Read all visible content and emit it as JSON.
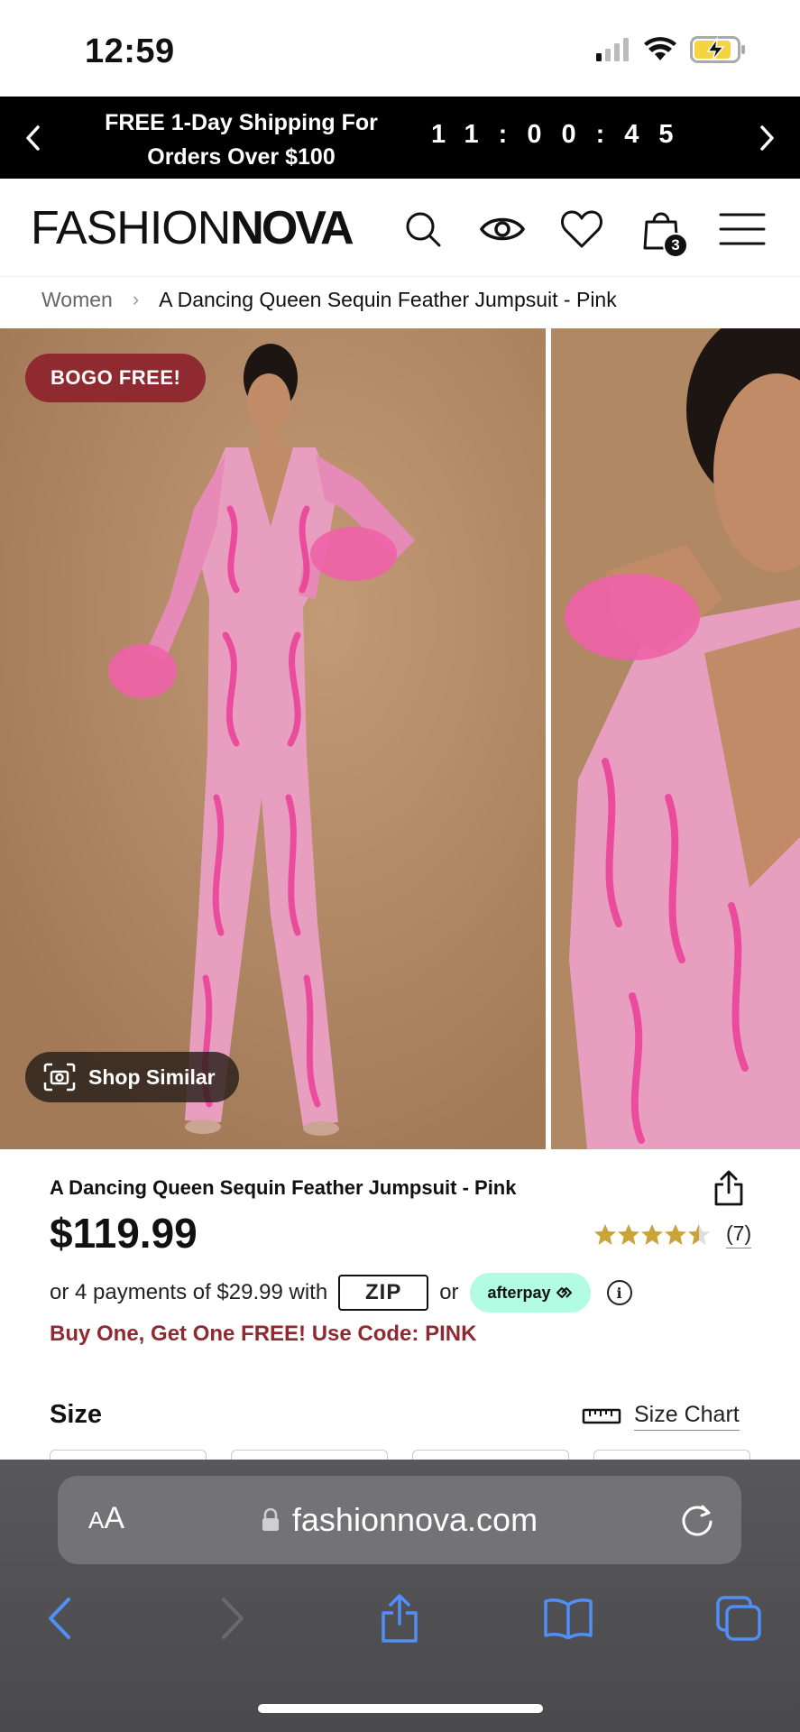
{
  "status_bar": {
    "time": "12:59"
  },
  "promo_banner": {
    "text_line1": "FREE 1-Day Shipping For",
    "text_line2": "Orders Over $100",
    "countdown": "11:00:45"
  },
  "header": {
    "logo_light": "FASHION",
    "logo_bold": "NOVA",
    "cart_count": "3",
    "icons": [
      "search-icon",
      "eye-icon",
      "heart-icon",
      "bag-icon",
      "menu-icon"
    ]
  },
  "breadcrumb": {
    "root": "Women",
    "current": "A Dancing Queen Sequin Feather Jumpsuit - Pink"
  },
  "gallery": {
    "badge": "BOGO FREE!",
    "shop_similar": "Shop Similar"
  },
  "product": {
    "title": "A Dancing Queen Sequin Feather Jumpsuit - Pink",
    "price": "$119.99",
    "rating": 4.5,
    "review_count": "(7)",
    "installment_prefix": "or 4 payments of $29.99 with",
    "zip_label": "ZIP",
    "or_label": "or",
    "afterpay_label": "afterpay",
    "promo_code_text": "Buy One, Get One FREE! Use Code: PINK",
    "size_heading": "Size",
    "size_chart_label": "Size Chart"
  },
  "browser": {
    "aa_label_small": "A",
    "aa_label_large": "A",
    "url": "fashionnova.com"
  },
  "colors": {
    "brand_red": "#8e2a30",
    "afterpay_mint": "#b2fce4",
    "star_gold": "#c9a43a",
    "toolbar_blue": "#4f8ff7",
    "battery_yellow": "#f5d442"
  }
}
